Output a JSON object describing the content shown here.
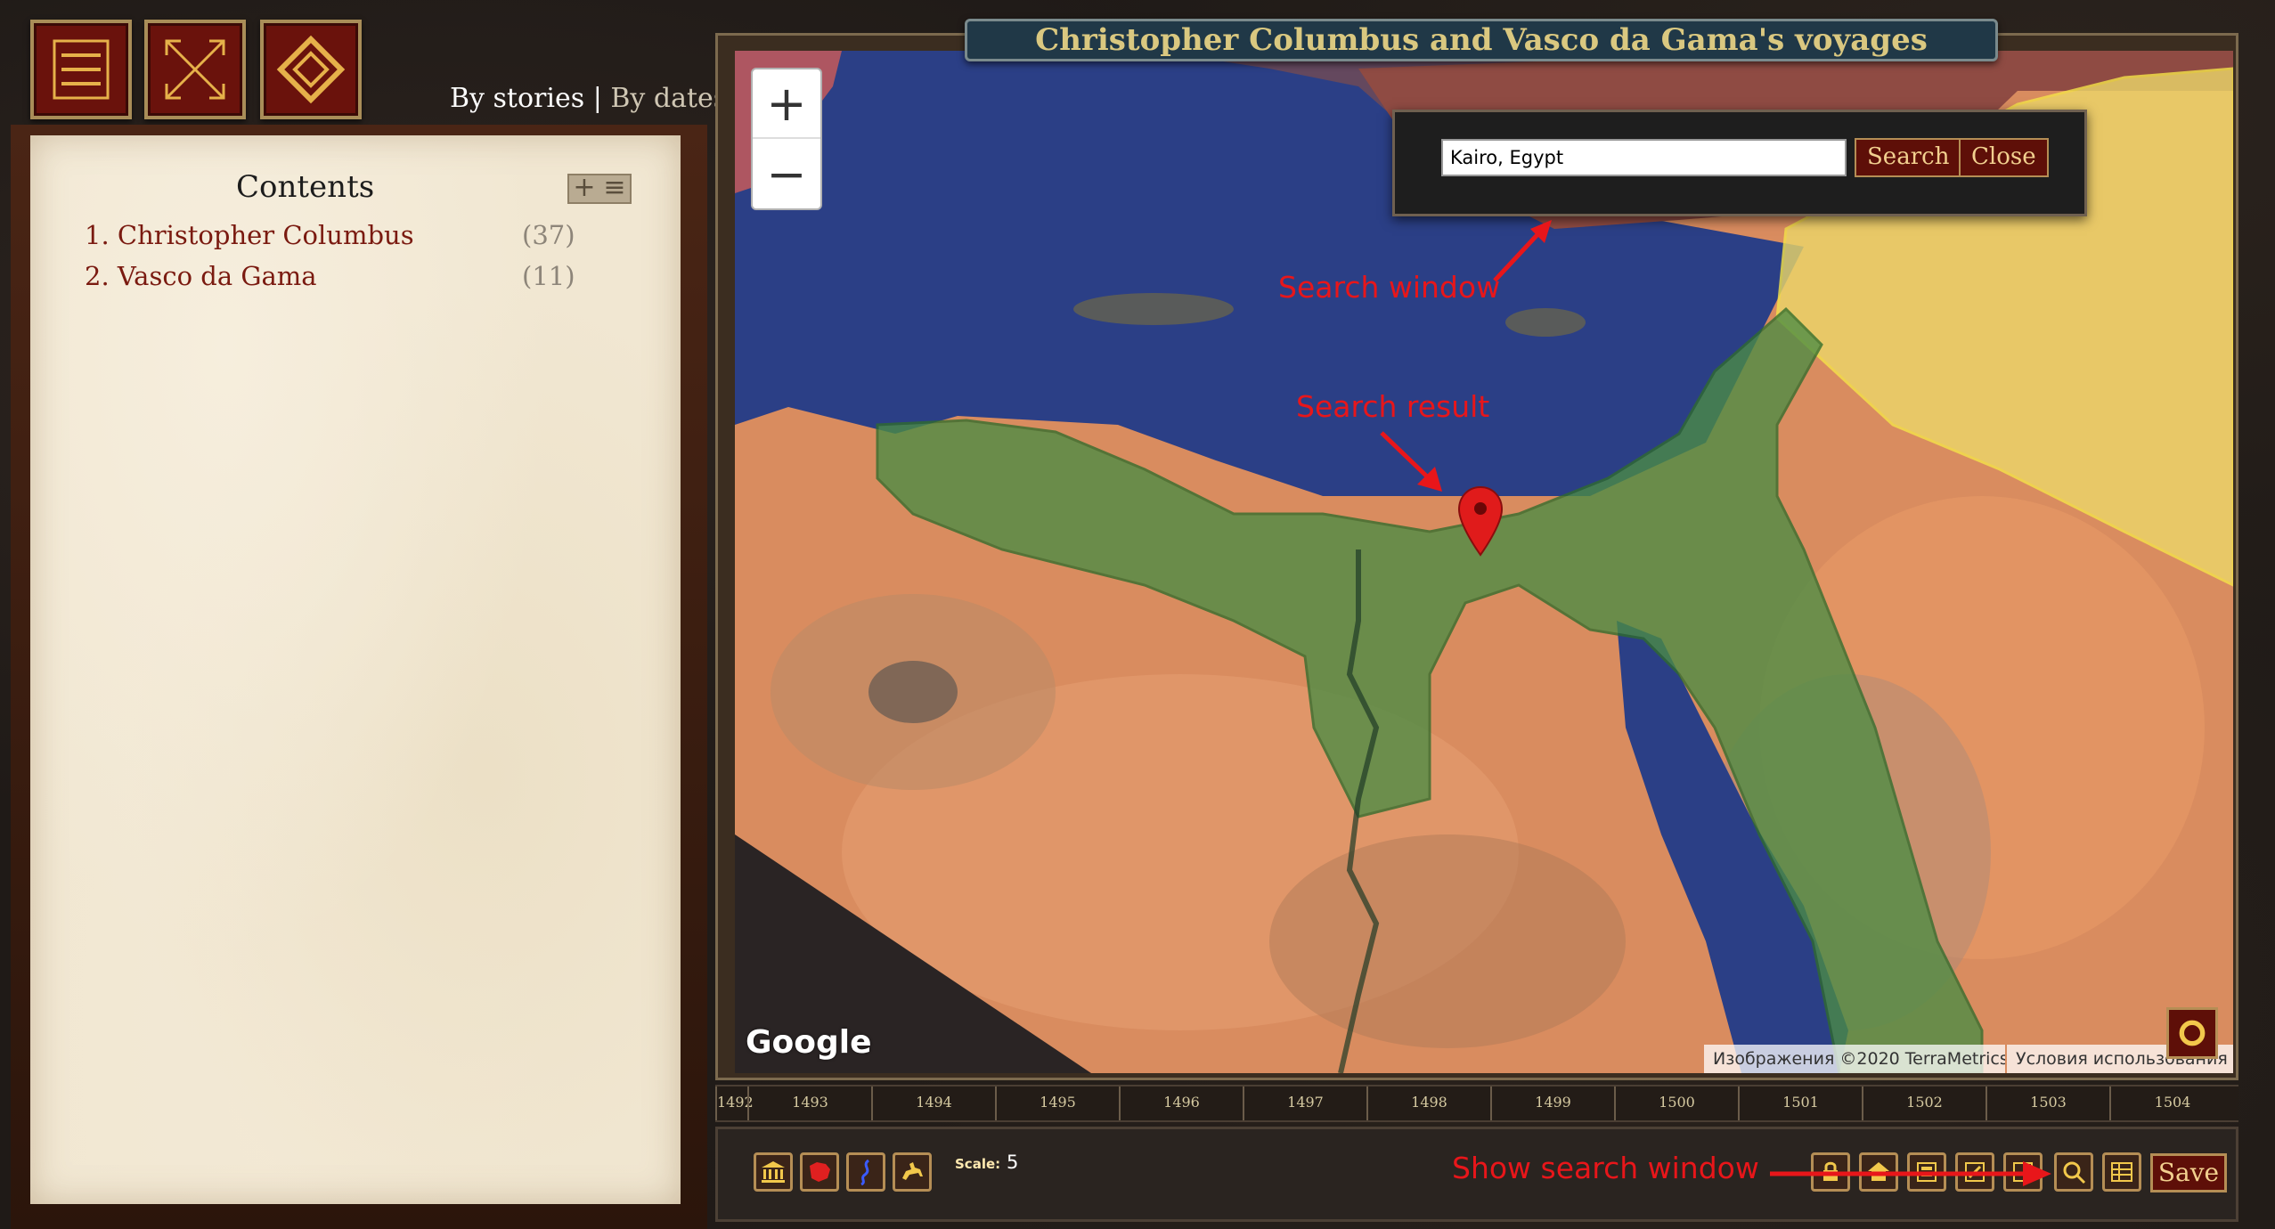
{
  "header": {
    "menu_icon": "hamburger-icon",
    "fullscreen_icon": "expand-arrows-icon",
    "third_icon": "diamond-eye-icon",
    "view_by_stories": "By stories",
    "view_separator": "|",
    "view_by_dates": "By dates"
  },
  "contents": {
    "title": "Contents",
    "expand_plus": "+",
    "expand_list": "≡",
    "items": [
      {
        "label": "1. Christopher Columbus",
        "count": "(37)"
      },
      {
        "label": "2. Vasco da Gama",
        "count": "(11)"
      }
    ]
  },
  "map": {
    "title": "Christopher Columbus and Vasco da Gama's voyages",
    "zoom_in": "+",
    "zoom_out": "−",
    "google_logo": "Google",
    "attribution": "Изображения ©2020 TerraMetrics",
    "terms": "Условия использования",
    "colors": {
      "sea": "#2b3f86",
      "desert": "#d98c5f",
      "highlight_green": "#4c8d45",
      "highlight_yellow": "#ecd86a",
      "highlight_red": "#b24d4d"
    }
  },
  "search": {
    "value": "Kairo, Egypt",
    "search_label": "Search",
    "close_label": "Close"
  },
  "annotations": {
    "search_window": "Search window",
    "search_result": "Search result",
    "show_search_window": "Show search window",
    "color": "#e8161a"
  },
  "timeline": {
    "years": [
      "1492",
      "1493",
      "1494",
      "1495",
      "1496",
      "1497",
      "1498",
      "1499",
      "1500",
      "1501",
      "1502",
      "1503",
      "1504"
    ]
  },
  "toolbar": {
    "left_icons": [
      "museum-icon",
      "map-shape-icon",
      "river-icon",
      "horseman-icon"
    ],
    "scale_label": "Scale:",
    "scale_value": "5",
    "right_icons": [
      "lock-icon",
      "home-icon",
      "layers-icon",
      "edit-icon",
      "share-icon",
      "search-icon",
      "grid-icon"
    ],
    "save_label": "Save"
  }
}
